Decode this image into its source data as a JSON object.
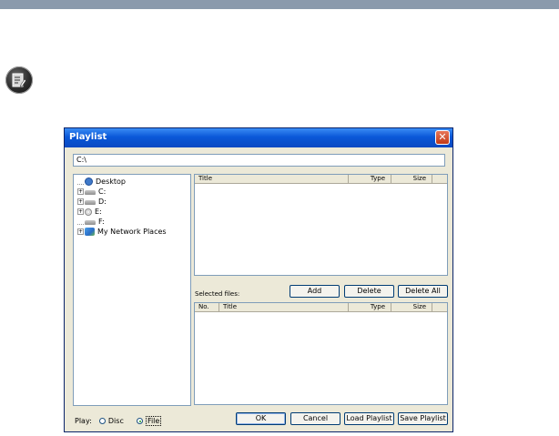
{
  "window": {
    "title": "Playlist",
    "path": "C:\\"
  },
  "tree": [
    {
      "label": "Desktop",
      "icon": "desktop-icon",
      "expander": ""
    },
    {
      "label": "C:",
      "icon": "drive-icon",
      "expander": "+"
    },
    {
      "label": "D:",
      "icon": "drive-icon",
      "expander": "+"
    },
    {
      "label": "E:",
      "icon": "cd-drive-icon",
      "expander": "+"
    },
    {
      "label": "F:",
      "icon": "drive-icon",
      "expander": ""
    },
    {
      "label": "My Network Places",
      "icon": "network-icon",
      "expander": "+"
    }
  ],
  "files_list": {
    "columns": [
      "Title",
      "Type",
      "Size"
    ]
  },
  "selected": {
    "label": "Selected files:",
    "columns": [
      "No.",
      "Title",
      "Type",
      "Size"
    ],
    "add": "Add",
    "delete": "Delete",
    "delete_all": "Delete All"
  },
  "play": {
    "label": "Play:",
    "disc": "Disc",
    "file": "File",
    "selected": "File"
  },
  "buttons": {
    "ok": "OK",
    "cancel": "Cancel",
    "load": "Load Playlist",
    "save": "Save Playlist"
  },
  "colors": {
    "titlebar": "#0a58d8",
    "window_bg": "#ece9d8",
    "topbar": "#8a9aac"
  }
}
